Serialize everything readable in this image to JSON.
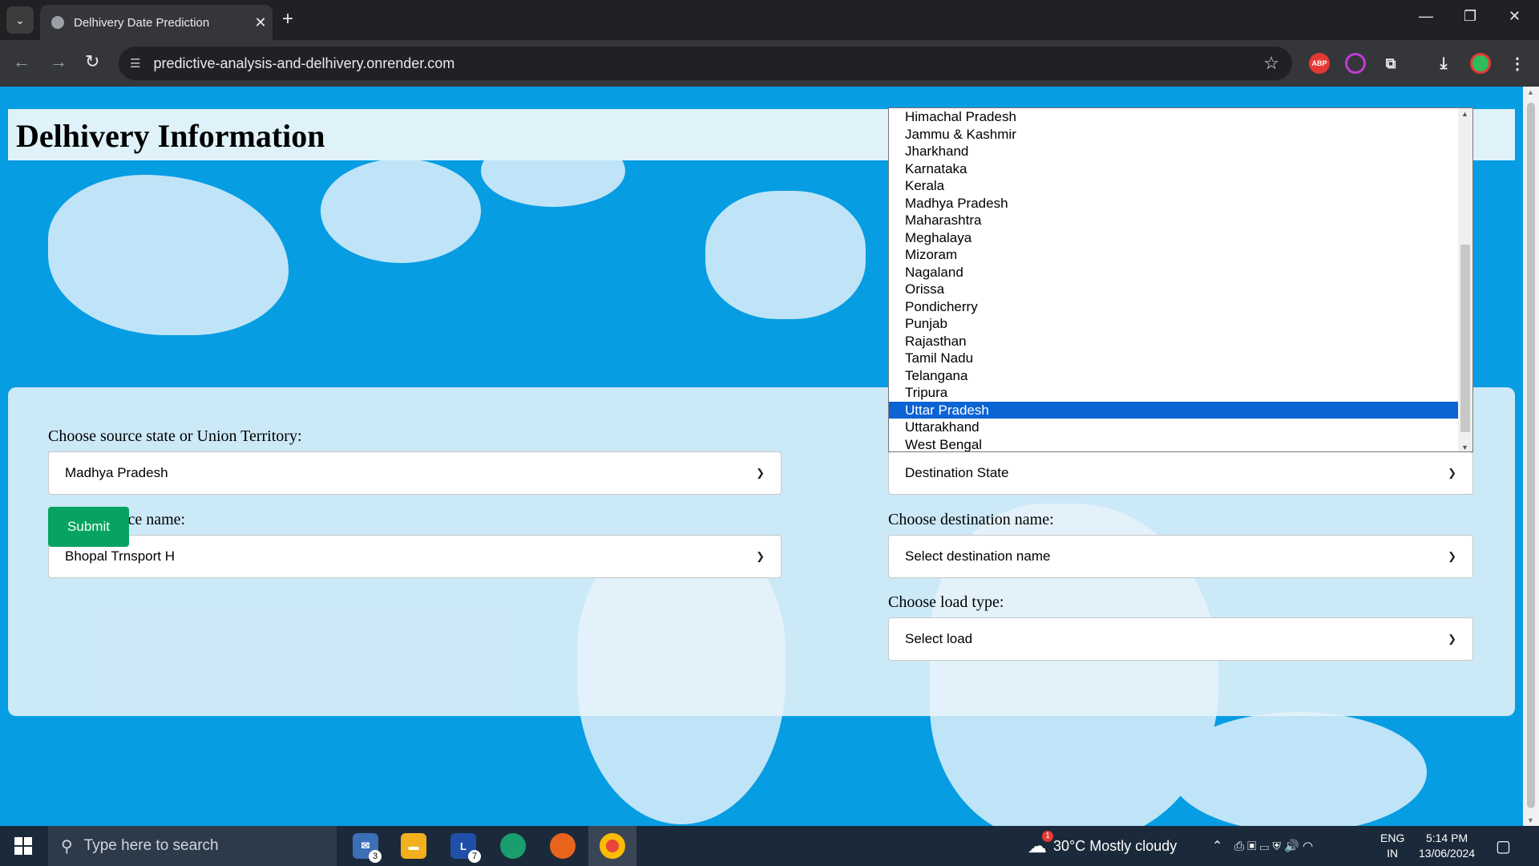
{
  "browser": {
    "tab_title": "Delhivery Date Prediction",
    "url": "predictive-analysis-and-delhivery.onrender.com",
    "ext_abp": "ABP"
  },
  "page": {
    "title": "Delhivery Information",
    "source_state_label": "Choose source state or Union Territory:",
    "source_state_value": "Madhya Pradesh",
    "source_name_label": "Choose source name:",
    "source_name_value": "Bhopal Trnsport H",
    "submit_label": "Submit",
    "destination_state_value": "Destination State",
    "destination_name_label": "Choose destination name:",
    "destination_name_value": "Select destination name",
    "load_label": "Choose load type:",
    "load_value": "Select load"
  },
  "dropdown": {
    "items": [
      "Himachal Pradesh",
      "Jammu & Kashmir",
      "Jharkhand",
      "Karnataka",
      "Kerala",
      "Madhya Pradesh",
      "Maharashtra",
      "Meghalaya",
      "Mizoram",
      "Nagaland",
      "Orissa",
      "Pondicherry",
      "Punjab",
      "Rajasthan",
      "Tamil Nadu",
      "Telangana",
      "Tripura",
      "Uttar Pradesh",
      "Uttarakhand",
      "West Bengal"
    ],
    "selected": "Uttar Pradesh"
  },
  "taskbar": {
    "search_placeholder": "Type here to search",
    "mail_badge": "3",
    "l_badge": "7",
    "weather_badge": "1",
    "weather": "30°C  Mostly cloudy",
    "lang_line1": "ENG",
    "lang_line2": "IN",
    "time": "5:14 PM",
    "date": "13/06/2024"
  },
  "colors": {
    "page_bg": "#069de3",
    "submit_bg": "#07a461",
    "selected_bg": "#0b63d4"
  }
}
